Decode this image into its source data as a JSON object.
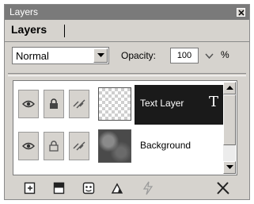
{
  "panel": {
    "title": "Layers",
    "tab_label": "Layers"
  },
  "blend_mode": {
    "value": "Normal"
  },
  "opacity": {
    "label": "Opacity:",
    "value": "100",
    "unit": "%"
  },
  "layers": [
    {
      "name": "Text Layer",
      "selected": true,
      "type_icon": "T"
    },
    {
      "name": "Background",
      "selected": false
    }
  ],
  "icons": {
    "title_close": "close-icon",
    "visibility": "eye-icon",
    "lock": "lock-icon",
    "link": "link-icon",
    "text_type": "text-type-icon",
    "new_layer": "new-layer-icon",
    "new_group": "new-group-icon",
    "layer_mask": "mask-icon",
    "adjustment": "adjustment-icon",
    "effects": "effects-icon",
    "delete": "delete-icon"
  },
  "colors": {
    "panel_bg": "#d6d3ce",
    "title_bar": "#7a7a7a",
    "selected_row": "#1a1a1a"
  }
}
